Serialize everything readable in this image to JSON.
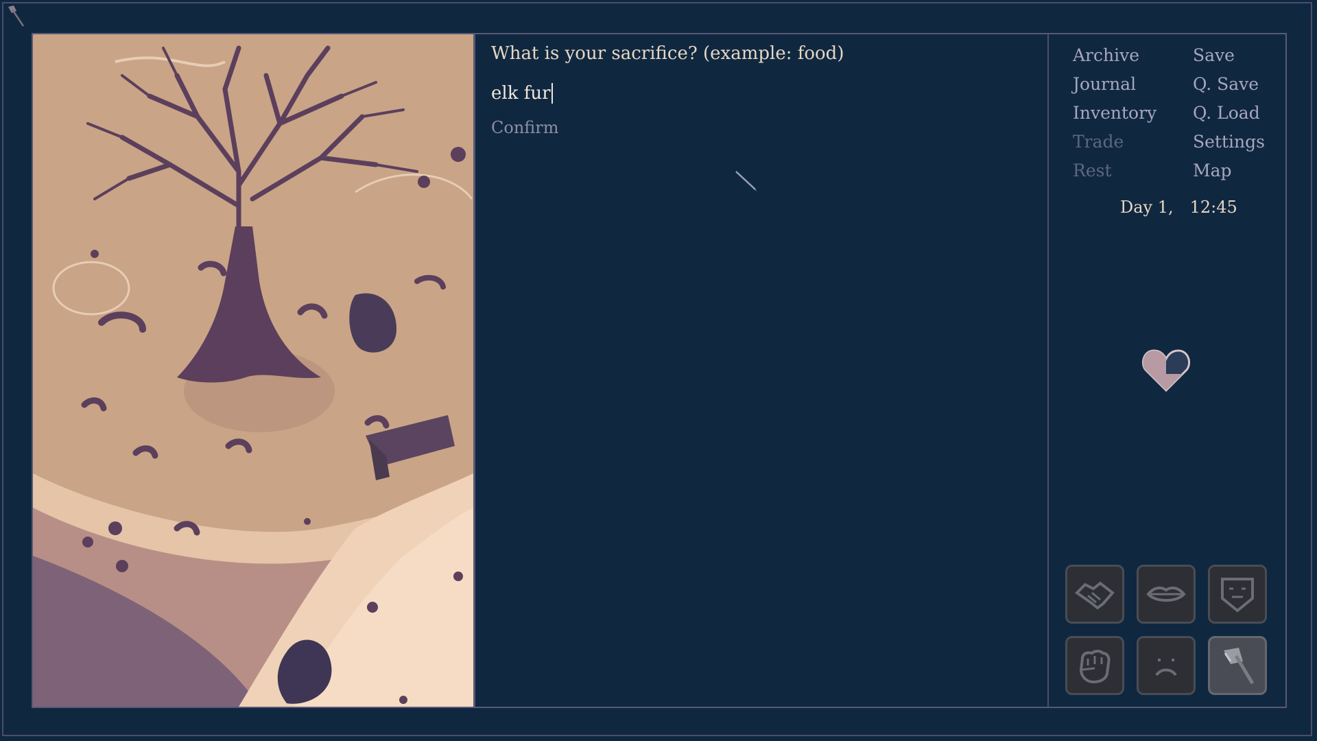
{
  "dialog": {
    "prompt": "What is your sacrifice? (example: food)",
    "answer": "elk fur",
    "confirm": "Confirm"
  },
  "menu": {
    "left": [
      {
        "label": "Archive",
        "enabled": true
      },
      {
        "label": "Journal",
        "enabled": true
      },
      {
        "label": "Inventory",
        "enabled": true
      },
      {
        "label": "Trade",
        "enabled": false
      },
      {
        "label": "Rest",
        "enabled": false
      }
    ],
    "right": [
      {
        "label": "Save",
        "enabled": true
      },
      {
        "label": "Q. Save",
        "enabled": true
      },
      {
        "label": "Q. Load",
        "enabled": true
      },
      {
        "label": "Settings",
        "enabled": true
      },
      {
        "label": "Map",
        "enabled": true
      }
    ]
  },
  "clock": {
    "day": "Day 1,",
    "time": "12:45"
  },
  "status": {
    "icon": "half-heart-icon",
    "health_fraction": 0.5
  },
  "actions": [
    {
      "icon": "handshake-icon",
      "active": false
    },
    {
      "icon": "lips-icon",
      "active": false
    },
    {
      "icon": "neutral-mask-icon",
      "active": false
    },
    {
      "icon": "fist-icon",
      "active": false
    },
    {
      "icon": "sad-face-icon",
      "active": false
    },
    {
      "icon": "axe-icon",
      "active": true
    }
  ],
  "colors": {
    "background": "#0f2840",
    "text": "#e8d6c3",
    "menu_text": "#a8a6be",
    "menu_disabled": "#5f6680",
    "frame": "#5a5877",
    "heart": "#b89aa5"
  }
}
